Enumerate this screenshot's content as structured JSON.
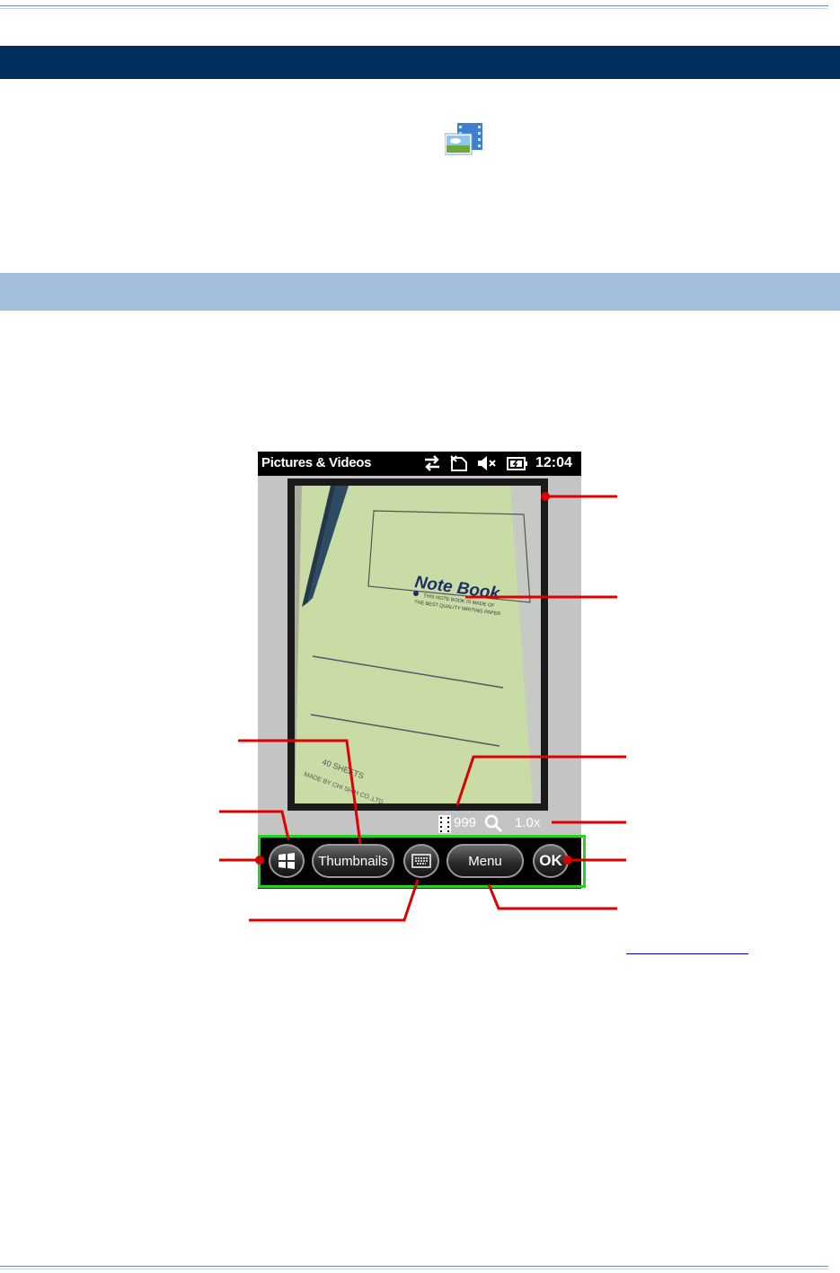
{
  "device": {
    "app_title": "Pictures & Videos",
    "clock": "12:04",
    "status_icons": [
      "sync-arrows-icon",
      "no-sim-icon",
      "speaker-muted-icon",
      "battery-charging-icon"
    ],
    "photo": {
      "notebook_title": "Note Book",
      "notebook_subtitle_line1": "THIS NOTE BOOK IS MADE OF",
      "notebook_subtitle_line2": "THE BEST QUALITY WRITING PAPER",
      "sheets_text": "40 SHEETS",
      "maker_text": "MADE BY CHI SHIH CO.,LTD"
    },
    "image_count": "999",
    "zoom_level": "1.0x",
    "softkeys": {
      "thumbnails_label": "Thumbnails",
      "menu_label": "Menu",
      "ok_label": "OK"
    }
  },
  "colors": {
    "section_bar_dark": "#002f5f",
    "section_bar_light": "#a3bfdc",
    "callout_red": "#dd0000",
    "softbar_highlight": "#22d41e"
  }
}
